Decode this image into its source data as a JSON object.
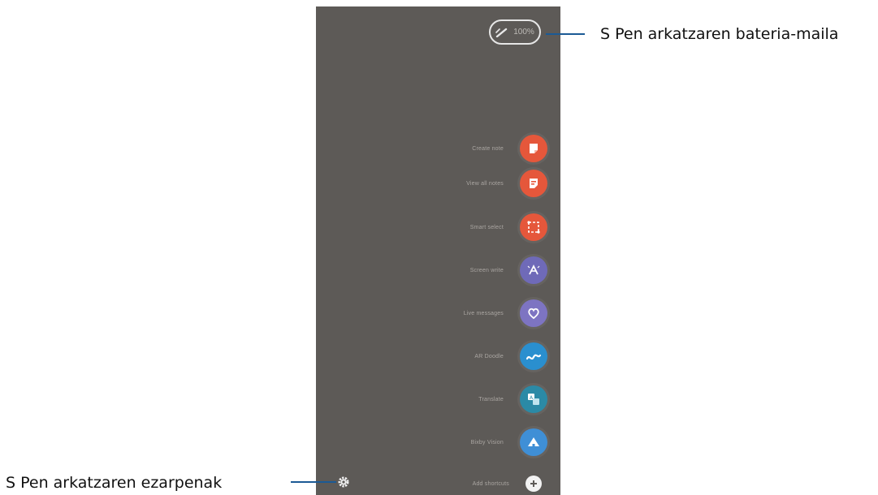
{
  "battery": {
    "level_text": "100%",
    "callout": "S Pen arkatzaren bateria-maila"
  },
  "settings": {
    "callout": "S Pen arkatzaren ezarpenak"
  },
  "menu": {
    "items": [
      {
        "label": "Create note",
        "icon": "create-note-icon",
        "color": "#e5573b"
      },
      {
        "label": "View all notes",
        "icon": "view-notes-icon",
        "color": "#e5573b"
      },
      {
        "label": "Smart select",
        "icon": "smart-select-icon",
        "color": "#e5573b"
      },
      {
        "label": "Screen write",
        "icon": "screen-write-icon",
        "color": "#6f6ab8"
      },
      {
        "label": "Live messages",
        "icon": "live-messages-icon",
        "color": "#7d74c2"
      },
      {
        "label": "AR Doodle",
        "icon": "ar-doodle-icon",
        "color": "#2a8fcf"
      },
      {
        "label": "Translate",
        "icon": "translate-icon",
        "color": "#2b8aa6"
      },
      {
        "label": "Bixby Vision",
        "icon": "bixby-vision-icon",
        "color": "#3f8fd6"
      }
    ],
    "add_label": "Add shortcuts"
  }
}
